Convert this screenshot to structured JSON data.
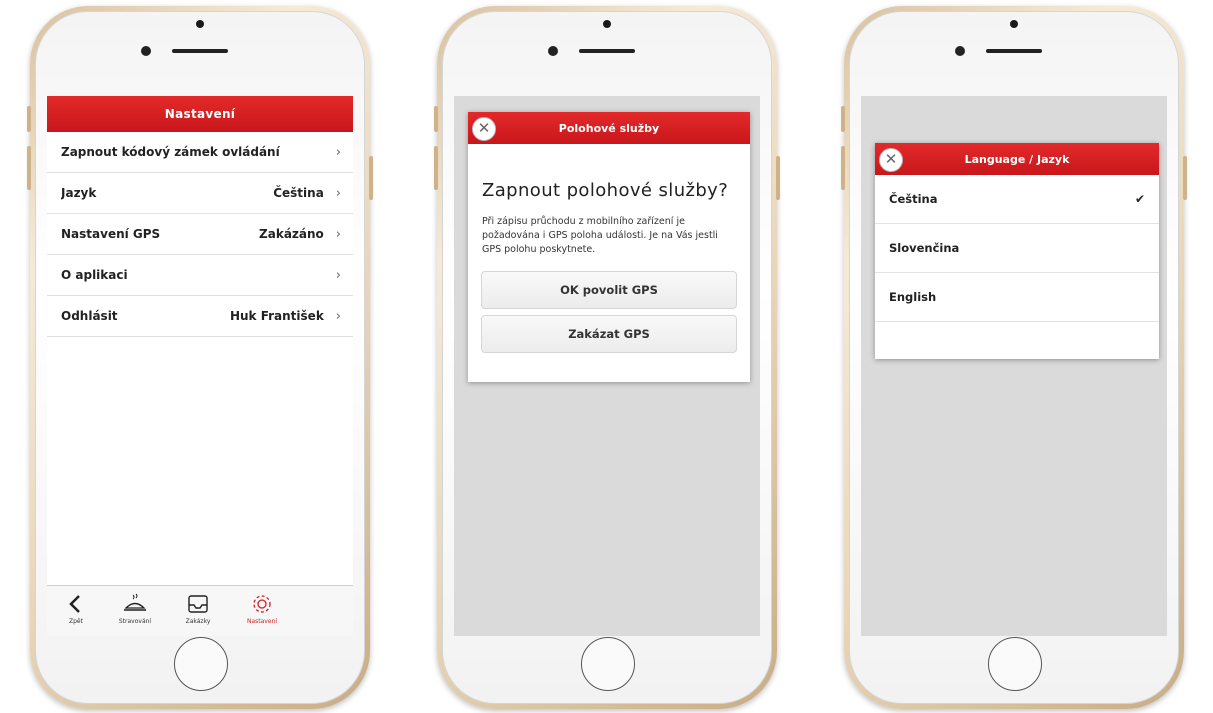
{
  "screen1": {
    "header_title": "Nastavení",
    "rows": [
      {
        "label": "Zapnout kódový zámek ovládání",
        "value": "",
        "chevron": "›"
      },
      {
        "label": "Jazyk",
        "value": "Čeština",
        "chevron": "›"
      },
      {
        "label": "Nastavení GPS",
        "value": "Zakázáno",
        "chevron": "›"
      },
      {
        "label": "O aplikaci",
        "value": "",
        "chevron": "›"
      },
      {
        "label": "Odhlásit",
        "value": "Huk František",
        "chevron": "›"
      }
    ],
    "tabs": [
      {
        "label": "Zpět",
        "icon": "back-chevron-icon"
      },
      {
        "label": "Stravování",
        "icon": "food-plate-icon"
      },
      {
        "label": "Zakázky",
        "icon": "inbox-tray-icon"
      },
      {
        "label": "Nastavení",
        "icon": "gear-icon",
        "active": true
      }
    ]
  },
  "screen2": {
    "dialog_header": "Polohové služby",
    "close_glyph": "✕",
    "title": "Zapnout polohové služby?",
    "text": "Při zápisu průchodu z mobilního zařízení je požadována i GPS poloha události. Je na Vás jestli GPS polohu poskytnete.",
    "buttons": {
      "allow": "OK povolit GPS",
      "deny": "Zakázat GPS"
    }
  },
  "screen3": {
    "dialog_header": "Language / Jazyk",
    "close_glyph": "✕",
    "languages": [
      {
        "label": "Čeština",
        "selected": "✔"
      },
      {
        "label": "Slovenčina",
        "selected": ""
      },
      {
        "label": "English",
        "selected": ""
      }
    ]
  },
  "colors": {
    "accent_red": "#d41c22",
    "overlay_gray": "#dadada"
  }
}
